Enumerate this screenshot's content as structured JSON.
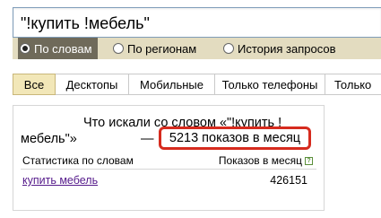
{
  "search": {
    "query": "\"!купить !мебель\""
  },
  "modes": [
    {
      "label": "По словам",
      "checked": true
    },
    {
      "label": "По регионам",
      "checked": false
    },
    {
      "label": "История запросов",
      "checked": false
    }
  ],
  "tabs": [
    {
      "label": "Все",
      "active": true
    },
    {
      "label": "Десктопы",
      "active": false
    },
    {
      "label": "Мобильные",
      "active": false
    },
    {
      "label": "Только телефоны",
      "active": false
    },
    {
      "label": "Только",
      "active": false
    }
  ],
  "panel": {
    "heading_line1": "Что искали со словом «\"!купить !",
    "heading_line2": "мебель\"»",
    "dash": "—",
    "impressions": "5213 показов в месяц",
    "col_left": "Статистика по словам",
    "col_right": "Показов в месяц",
    "help": "?",
    "rows": [
      {
        "keyword": "купить мебель",
        "count": "426151"
      }
    ]
  },
  "colors": {
    "highlight_border": "#d62b1e",
    "mode_bar": "#e3dcc0",
    "active_tab": "#f2e7b8",
    "visited_link": "#551a8b"
  }
}
